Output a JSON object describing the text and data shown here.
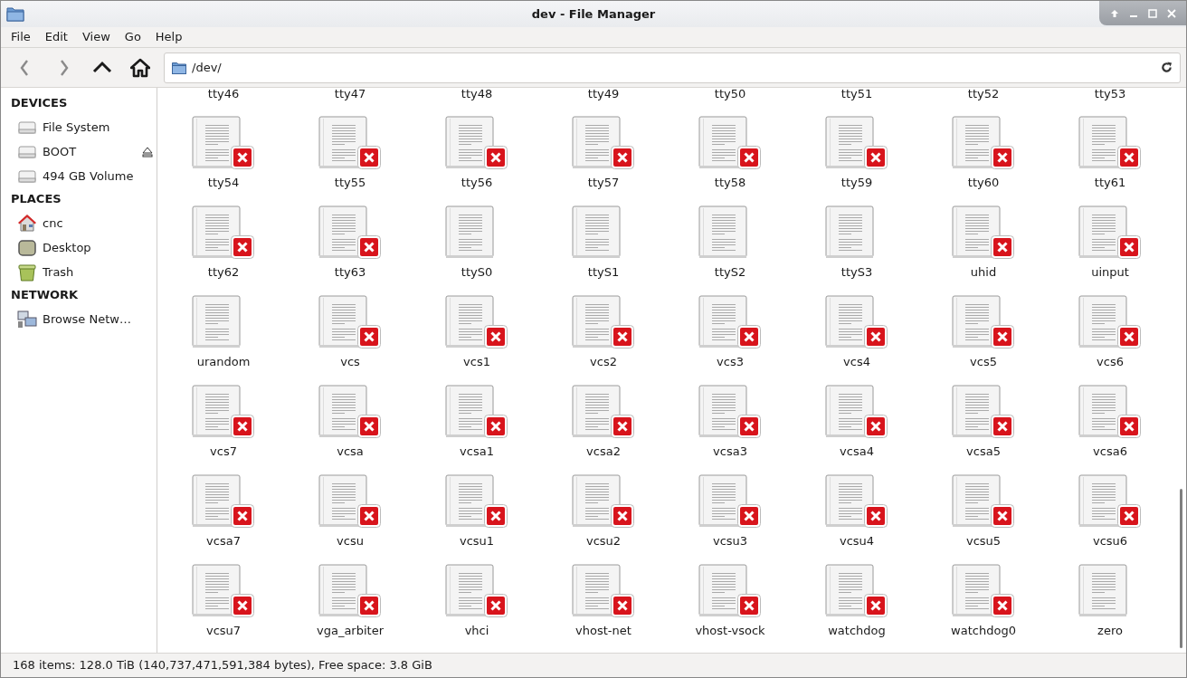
{
  "window": {
    "title": "dev - File Manager"
  },
  "menu": [
    "File",
    "Edit",
    "View",
    "Go",
    "Help"
  ],
  "nav_buttons": [
    {
      "kind": "back",
      "disabled": true
    },
    {
      "kind": "forward",
      "disabled": true
    },
    {
      "kind": "up",
      "disabled": false
    },
    {
      "kind": "home",
      "disabled": false
    }
  ],
  "location": {
    "path": "/dev/"
  },
  "sidebar": [
    {
      "heading": "DEVICES",
      "items": [
        {
          "label": "File System",
          "kind": "drive",
          "ejectable": false
        },
        {
          "label": "BOOT",
          "kind": "drive",
          "ejectable": true
        },
        {
          "label": "494 GB Volume",
          "kind": "drive",
          "ejectable": false
        }
      ]
    },
    {
      "heading": "PLACES",
      "items": [
        {
          "label": "cnc",
          "kind": "home",
          "ejectable": false
        },
        {
          "label": "Desktop",
          "kind": "desktop",
          "ejectable": false
        },
        {
          "label": "Trash",
          "kind": "trash",
          "ejectable": false
        }
      ]
    },
    {
      "heading": "NETWORK",
      "items": [
        {
          "label": "Browse Netw…",
          "kind": "network",
          "ejectable": false
        }
      ]
    }
  ],
  "cut_off_row": [
    "tty46",
    "tty47",
    "tty48",
    "tty49",
    "tty50",
    "tty51",
    "tty52",
    "tty53"
  ],
  "files": [
    {
      "name": "tty54",
      "locked": true
    },
    {
      "name": "tty55",
      "locked": true
    },
    {
      "name": "tty56",
      "locked": true
    },
    {
      "name": "tty57",
      "locked": true
    },
    {
      "name": "tty58",
      "locked": true
    },
    {
      "name": "tty59",
      "locked": true
    },
    {
      "name": "tty60",
      "locked": true
    },
    {
      "name": "tty61",
      "locked": true
    },
    {
      "name": "tty62",
      "locked": true
    },
    {
      "name": "tty63",
      "locked": true
    },
    {
      "name": "ttyS0",
      "locked": false
    },
    {
      "name": "ttyS1",
      "locked": false
    },
    {
      "name": "ttyS2",
      "locked": false
    },
    {
      "name": "ttyS3",
      "locked": false
    },
    {
      "name": "uhid",
      "locked": true
    },
    {
      "name": "uinput",
      "locked": true
    },
    {
      "name": "urandom",
      "locked": false
    },
    {
      "name": "vcs",
      "locked": true
    },
    {
      "name": "vcs1",
      "locked": true
    },
    {
      "name": "vcs2",
      "locked": true
    },
    {
      "name": "vcs3",
      "locked": true
    },
    {
      "name": "vcs4",
      "locked": true
    },
    {
      "name": "vcs5",
      "locked": true
    },
    {
      "name": "vcs6",
      "locked": true
    },
    {
      "name": "vcs7",
      "locked": true
    },
    {
      "name": "vcsa",
      "locked": true
    },
    {
      "name": "vcsa1",
      "locked": true
    },
    {
      "name": "vcsa2",
      "locked": true
    },
    {
      "name": "vcsa3",
      "locked": true
    },
    {
      "name": "vcsa4",
      "locked": true
    },
    {
      "name": "vcsa5",
      "locked": true
    },
    {
      "name": "vcsa6",
      "locked": true
    },
    {
      "name": "vcsa7",
      "locked": true
    },
    {
      "name": "vcsu",
      "locked": true
    },
    {
      "name": "vcsu1",
      "locked": true
    },
    {
      "name": "vcsu2",
      "locked": true
    },
    {
      "name": "vcsu3",
      "locked": true
    },
    {
      "name": "vcsu4",
      "locked": true
    },
    {
      "name": "vcsu5",
      "locked": true
    },
    {
      "name": "vcsu6",
      "locked": true
    },
    {
      "name": "vcsu7",
      "locked": true
    },
    {
      "name": "vga_arbiter",
      "locked": true
    },
    {
      "name": "vhci",
      "locked": true
    },
    {
      "name": "vhost-net",
      "locked": true
    },
    {
      "name": "vhost-vsock",
      "locked": true
    },
    {
      "name": "watchdog",
      "locked": true
    },
    {
      "name": "watchdog0",
      "locked": true
    },
    {
      "name": "zero",
      "locked": false
    }
  ],
  "status_bar": "168 items: 128.0 TiB (140,737,471,591,384 bytes), Free space: 3.8 GiB"
}
